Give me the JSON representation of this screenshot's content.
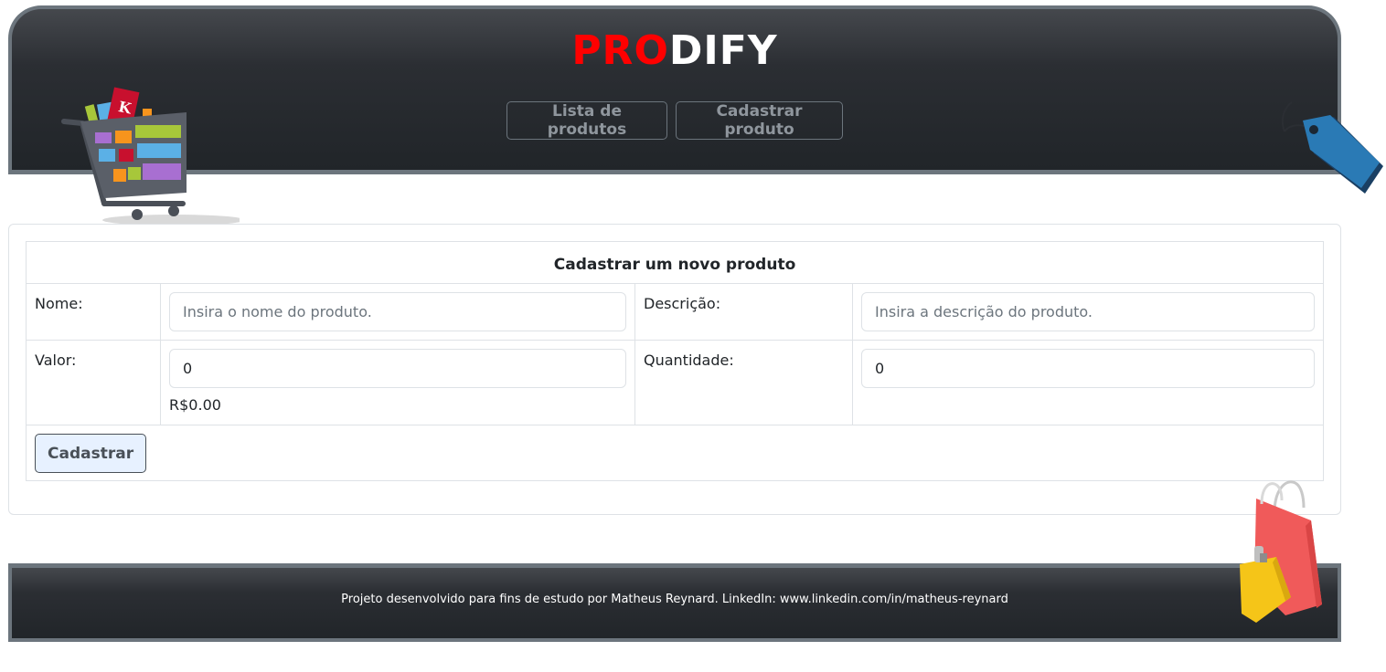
{
  "header": {
    "brand_part1": "PRO",
    "brand_part2": "DIFY",
    "nav": [
      {
        "label": "Lista de produtos"
      },
      {
        "label": "Cadastrar produto"
      }
    ]
  },
  "form": {
    "title": "Cadastrar um novo produto",
    "nome_label": "Nome:",
    "nome_placeholder": "Insira o nome do produto.",
    "descricao_label": "Descrição:",
    "descricao_placeholder": "Insira a descrição do produto.",
    "valor_label": "Valor:",
    "valor_value": "0",
    "valor_formatted": "R$0.00",
    "quantidade_label": "Quantidade:",
    "quantidade_value": "0",
    "submit_label": "Cadastrar"
  },
  "footer": {
    "text": "Projeto desenvolvido para fins de estudo por Matheus Reynard. LinkedIn: www.linkedin.com/in/matheus-reynard"
  },
  "colors": {
    "header_bg": "#212529",
    "brand_red": "#ff0000",
    "border_gray": "#6c757d",
    "button_bg": "#e7f1ff"
  },
  "icons": [
    "shopping-cart-icon",
    "price-tag-icon",
    "shopping-bags-icon"
  ]
}
